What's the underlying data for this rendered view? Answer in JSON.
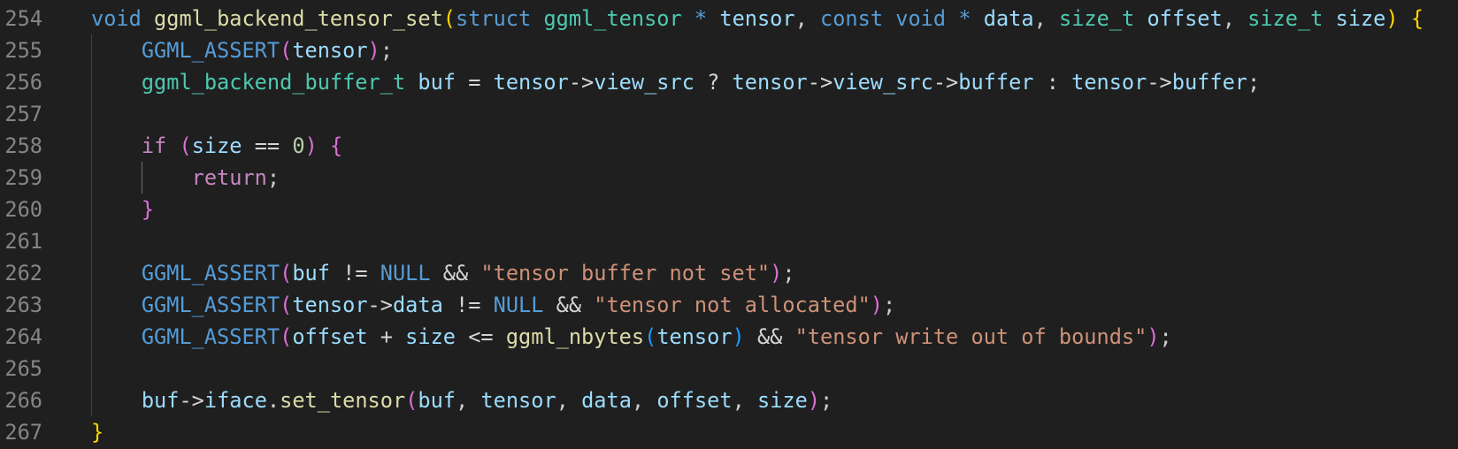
{
  "editor": {
    "colors": {
      "background": "#1f1f1f",
      "line_number": "#858585",
      "keyword": "#569cd6",
      "control": "#c586c0",
      "function": "#dcdcaa",
      "type": "#4ec9b0",
      "variable": "#9cdcfe",
      "string": "#ce9178",
      "number": "#b5cea8",
      "bracket_level_1": "#ffd700",
      "bracket_level_2": "#da70d6",
      "bracket_level_3": "#179fff"
    },
    "lines": [
      {
        "number": "254",
        "tokens": [
          {
            "t": "void",
            "c": "kw"
          },
          {
            "t": " ",
            "c": "punc"
          },
          {
            "t": "ggml_backend_tensor_set",
            "c": "fn"
          },
          {
            "t": "(",
            "c": "b1"
          },
          {
            "t": "struct",
            "c": "kw"
          },
          {
            "t": " ",
            "c": "punc"
          },
          {
            "t": "ggml_tensor",
            "c": "type"
          },
          {
            "t": " ",
            "c": "punc"
          },
          {
            "t": "*",
            "c": "kw"
          },
          {
            "t": " ",
            "c": "punc"
          },
          {
            "t": "tensor",
            "c": "var"
          },
          {
            "t": ", ",
            "c": "punc"
          },
          {
            "t": "const",
            "c": "kw"
          },
          {
            "t": " ",
            "c": "punc"
          },
          {
            "t": "void",
            "c": "kw"
          },
          {
            "t": " ",
            "c": "punc"
          },
          {
            "t": "*",
            "c": "kw"
          },
          {
            "t": " ",
            "c": "punc"
          },
          {
            "t": "data",
            "c": "var"
          },
          {
            "t": ", ",
            "c": "punc"
          },
          {
            "t": "size_t",
            "c": "type"
          },
          {
            "t": " ",
            "c": "punc"
          },
          {
            "t": "offset",
            "c": "var"
          },
          {
            "t": ", ",
            "c": "punc"
          },
          {
            "t": "size_t",
            "c": "type"
          },
          {
            "t": " ",
            "c": "punc"
          },
          {
            "t": "size",
            "c": "var"
          },
          {
            "t": ")",
            "c": "b1"
          },
          {
            "t": " ",
            "c": "punc"
          },
          {
            "t": "{",
            "c": "b1"
          }
        ]
      },
      {
        "number": "255",
        "indent": "    ",
        "tokens": [
          {
            "t": "GGML_ASSERT",
            "c": "macro"
          },
          {
            "t": "(",
            "c": "b2"
          },
          {
            "t": "tensor",
            "c": "var"
          },
          {
            "t": ")",
            "c": "b2"
          },
          {
            "t": ";",
            "c": "punc"
          }
        ]
      },
      {
        "number": "256",
        "indent": "    ",
        "tokens": [
          {
            "t": "ggml_backend_buffer_t",
            "c": "type"
          },
          {
            "t": " ",
            "c": "punc"
          },
          {
            "t": "buf",
            "c": "var"
          },
          {
            "t": " = ",
            "c": "op"
          },
          {
            "t": "tensor",
            "c": "var"
          },
          {
            "t": "->",
            "c": "op"
          },
          {
            "t": "view_src",
            "c": "var"
          },
          {
            "t": " ? ",
            "c": "op"
          },
          {
            "t": "tensor",
            "c": "var"
          },
          {
            "t": "->",
            "c": "op"
          },
          {
            "t": "view_src",
            "c": "var"
          },
          {
            "t": "->",
            "c": "op"
          },
          {
            "t": "buffer",
            "c": "var"
          },
          {
            "t": " : ",
            "c": "op"
          },
          {
            "t": "tensor",
            "c": "var"
          },
          {
            "t": "->",
            "c": "op"
          },
          {
            "t": "buffer",
            "c": "var"
          },
          {
            "t": ";",
            "c": "punc"
          }
        ]
      },
      {
        "number": "257",
        "tokens": []
      },
      {
        "number": "258",
        "indent": "    ",
        "tokens": [
          {
            "t": "if",
            "c": "ctrl"
          },
          {
            "t": " ",
            "c": "punc"
          },
          {
            "t": "(",
            "c": "b2"
          },
          {
            "t": "size",
            "c": "var"
          },
          {
            "t": " == ",
            "c": "op"
          },
          {
            "t": "0",
            "c": "num"
          },
          {
            "t": ")",
            "c": "b2"
          },
          {
            "t": " ",
            "c": "punc"
          },
          {
            "t": "{",
            "c": "b2"
          }
        ]
      },
      {
        "number": "259",
        "indent": "        ",
        "tokens": [
          {
            "t": "return",
            "c": "ctrl"
          },
          {
            "t": ";",
            "c": "punc"
          }
        ]
      },
      {
        "number": "260",
        "indent": "    ",
        "tokens": [
          {
            "t": "}",
            "c": "b2"
          }
        ]
      },
      {
        "number": "261",
        "tokens": []
      },
      {
        "number": "262",
        "indent": "    ",
        "tokens": [
          {
            "t": "GGML_ASSERT",
            "c": "macro"
          },
          {
            "t": "(",
            "c": "b2"
          },
          {
            "t": "buf",
            "c": "var"
          },
          {
            "t": " != ",
            "c": "op"
          },
          {
            "t": "NULL",
            "c": "kw"
          },
          {
            "t": " && ",
            "c": "op"
          },
          {
            "t": "\"tensor buffer not set\"",
            "c": "str"
          },
          {
            "t": ")",
            "c": "b2"
          },
          {
            "t": ";",
            "c": "punc"
          }
        ]
      },
      {
        "number": "263",
        "indent": "    ",
        "tokens": [
          {
            "t": "GGML_ASSERT",
            "c": "macro"
          },
          {
            "t": "(",
            "c": "b2"
          },
          {
            "t": "tensor",
            "c": "var"
          },
          {
            "t": "->",
            "c": "op"
          },
          {
            "t": "data",
            "c": "var"
          },
          {
            "t": " != ",
            "c": "op"
          },
          {
            "t": "NULL",
            "c": "kw"
          },
          {
            "t": " && ",
            "c": "op"
          },
          {
            "t": "\"tensor not allocated\"",
            "c": "str"
          },
          {
            "t": ")",
            "c": "b2"
          },
          {
            "t": ";",
            "c": "punc"
          }
        ]
      },
      {
        "number": "264",
        "indent": "    ",
        "tokens": [
          {
            "t": "GGML_ASSERT",
            "c": "macro"
          },
          {
            "t": "(",
            "c": "b2"
          },
          {
            "t": "offset",
            "c": "var"
          },
          {
            "t": " + ",
            "c": "op"
          },
          {
            "t": "size",
            "c": "var"
          },
          {
            "t": " <= ",
            "c": "op"
          },
          {
            "t": "ggml_nbytes",
            "c": "fn"
          },
          {
            "t": "(",
            "c": "b3"
          },
          {
            "t": "tensor",
            "c": "var"
          },
          {
            "t": ")",
            "c": "b3"
          },
          {
            "t": " && ",
            "c": "op"
          },
          {
            "t": "\"tensor write out of bounds\"",
            "c": "str"
          },
          {
            "t": ")",
            "c": "b2"
          },
          {
            "t": ";",
            "c": "punc"
          }
        ]
      },
      {
        "number": "265",
        "tokens": []
      },
      {
        "number": "266",
        "indent": "    ",
        "tokens": [
          {
            "t": "buf",
            "c": "var"
          },
          {
            "t": "->",
            "c": "op"
          },
          {
            "t": "iface",
            "c": "var"
          },
          {
            "t": ".",
            "c": "op"
          },
          {
            "t": "set_tensor",
            "c": "fn"
          },
          {
            "t": "(",
            "c": "b2"
          },
          {
            "t": "buf",
            "c": "var"
          },
          {
            "t": ", ",
            "c": "punc"
          },
          {
            "t": "tensor",
            "c": "var"
          },
          {
            "t": ", ",
            "c": "punc"
          },
          {
            "t": "data",
            "c": "var"
          },
          {
            "t": ", ",
            "c": "punc"
          },
          {
            "t": "offset",
            "c": "var"
          },
          {
            "t": ", ",
            "c": "punc"
          },
          {
            "t": "size",
            "c": "var"
          },
          {
            "t": ")",
            "c": "b2"
          },
          {
            "t": ";",
            "c": "punc"
          }
        ]
      },
      {
        "number": "267",
        "tokens": [
          {
            "t": "}",
            "c": "b1"
          }
        ]
      }
    ]
  }
}
